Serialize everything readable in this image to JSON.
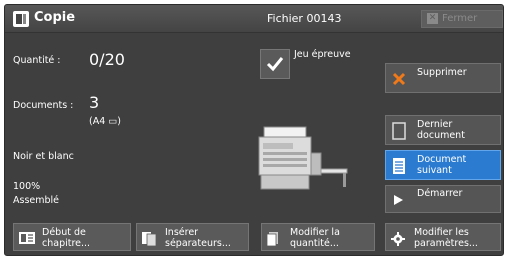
{
  "header": {
    "app_title": "Copie",
    "file_label": "Fichier 00143",
    "close_label": "Fermer"
  },
  "settings": {
    "quantity_label": "Quantité :",
    "quantity_value": "0/20",
    "documents_label": "Documents :",
    "documents_value": "3",
    "documents_format": "(A4 ▭)",
    "color_mode": "Noir et blanc",
    "zoom": "100%",
    "collation": "Assemblé"
  },
  "proof": {
    "label": "Jeu épreuve",
    "checked": true
  },
  "side_buttons": {
    "delete": "Supprimer",
    "last_document": "Dernier document",
    "next_document": "Document suivant",
    "start": "Démarrer"
  },
  "bottom_buttons": {
    "chapter_start": "Début de chapitre...",
    "insert_separators": "Insérer séparateurs...",
    "change_quantity": "Modifier la quantité...",
    "change_parameters": "Modifier les paramètres..."
  },
  "colors": {
    "panel": "#3f3f3f",
    "accent_blue": "#2b7bd1",
    "delete_orange": "#f07a1a"
  },
  "icons": [
    "copy-app-icon",
    "close-icon",
    "checkmark-icon",
    "cross-icon",
    "document-icon",
    "list-document-icon",
    "play-icon",
    "chapter-icon",
    "separator-icon",
    "quantity-icon",
    "gear-icon",
    "printer-illustration"
  ]
}
